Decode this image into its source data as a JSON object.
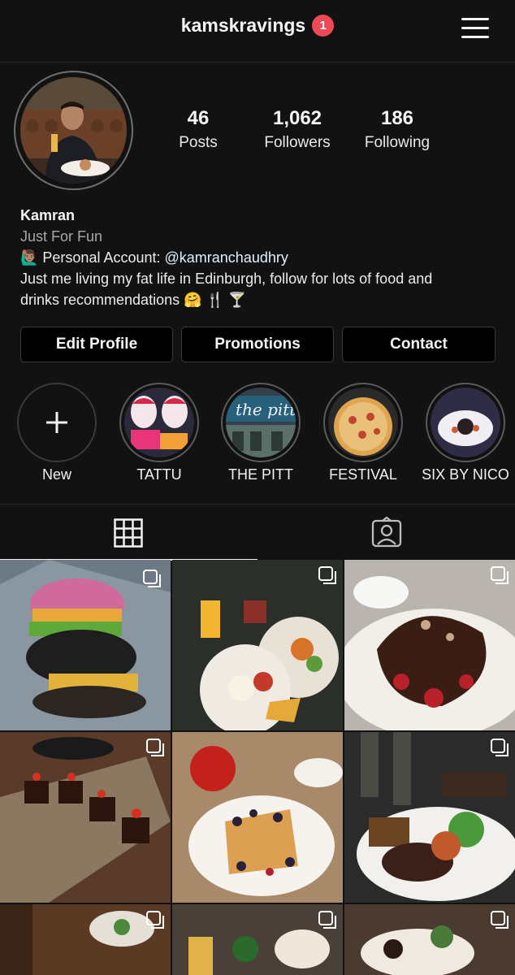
{
  "header": {
    "username": "kamskravings",
    "notification_count": "1"
  },
  "profile": {
    "stats": [
      {
        "value": "46",
        "label": "Posts"
      },
      {
        "value": "1,062",
        "label": "Followers"
      },
      {
        "value": "186",
        "label": "Following"
      }
    ],
    "name": "Kamran",
    "category": "Just For Fun",
    "bio_line1_prefix": "🙋🏽‍♂️ Personal Account: ",
    "bio_mention": "@kamranchaudhry",
    "bio_line2": "Just me living my fat life in Edinburgh, follow for lots of food and",
    "bio_line3": "drinks recommendations 🤗 🍴 🍸"
  },
  "actions": {
    "edit_profile": "Edit Profile",
    "promotions": "Promotions",
    "contact": "Contact"
  },
  "highlights": [
    {
      "label": "New",
      "icon": "plus-icon"
    },
    {
      "label": "TATTU"
    },
    {
      "label": "THE PITT"
    },
    {
      "label": "FESTIVAL"
    },
    {
      "label": "SIX BY NICO"
    }
  ],
  "tabs": [
    {
      "name": "grid-view",
      "icon": "grid-icon",
      "active": true
    },
    {
      "name": "tagged",
      "icon": "tagged-person-icon",
      "active": false
    }
  ],
  "grid": {
    "multi_post_icon": "multiple-posts-icon",
    "posts_visible": 9
  },
  "colors": {
    "background": "#121212",
    "badge": "#ed4956",
    "button_bg": "#000000",
    "border": "#3a3a3a"
  }
}
